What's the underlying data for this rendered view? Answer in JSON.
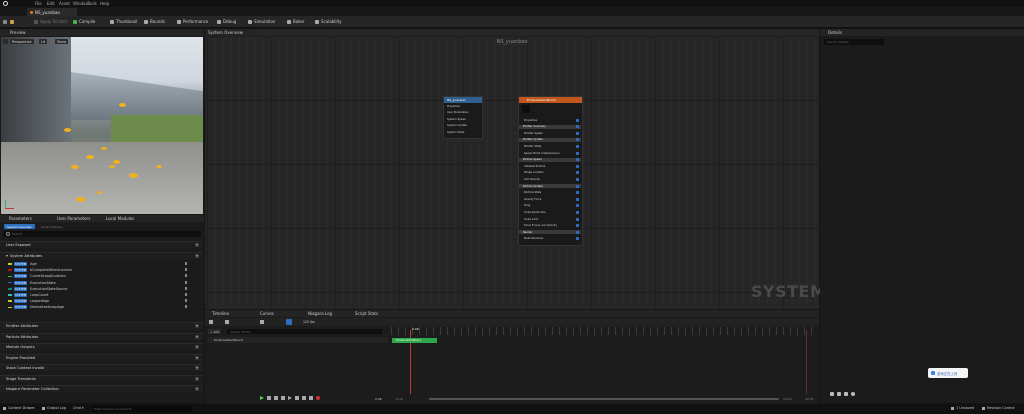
{
  "menu": [
    "File",
    "Edit",
    "Asset",
    "Window",
    "Tools",
    "Help"
  ],
  "tab": {
    "title": "NS_yuanbao"
  },
  "toolbar": {
    "apply": "Apply Scratch",
    "compile": "Compile",
    "thumbnail": "Thumbnail",
    "bounds": "Bounds",
    "performance": "Performance",
    "debug": "Debug",
    "simulation": "Simulation",
    "baker": "Baker",
    "scalability": "Scalability"
  },
  "preview": {
    "tab": "Preview",
    "view_mode": "Perspective",
    "lit": "Lit",
    "show": "Show"
  },
  "params": {
    "tabs": [
      "Parameters",
      "User Parameters",
      "Local Modules"
    ],
    "subtabs": [
      "System Overview",
      "Scratch Module"
    ],
    "search_placeholder": "Search",
    "user_exposed": "User Exposed",
    "system_attributes": "System Attributes",
    "system_tag": "SYSTEM",
    "attributes": [
      {
        "name": "Age",
        "color": "#c0d020"
      },
      {
        "name": "bCompleteWhenInactive",
        "color": "#b01818"
      },
      {
        "name": "CurrentLoopDuration",
        "color": "#30c030"
      },
      {
        "name": "ExecutionState",
        "color": "#3060c0"
      },
      {
        "name": "ExecutionStateSource",
        "color": "#108070"
      },
      {
        "name": "LoopCount",
        "color": "#30c0c0"
      },
      {
        "name": "LoopedAge",
        "color": "#c0d020"
      },
      {
        "name": "NormalizedLoopAge",
        "color": "#c0d020"
      }
    ],
    "categories": [
      "Emitter Attributes",
      "Particle Attributes",
      "Module Outputs",
      "Engine Provided",
      "Stack Context Invalid",
      "Stage Transients",
      "Niagara Parameter Collection"
    ]
  },
  "overview": {
    "tab": "System Overview",
    "title": "NS_yuanbao",
    "watermark": "SYSTEM",
    "system_node": {
      "title": "NS_yuanbao",
      "rows": [
        "Properties",
        "User Parameters",
        "System Spawn",
        "System Update",
        "System State"
      ]
    },
    "emitter_node": {
      "title": "EmissiveItemBoard",
      "rows": [
        {
          "label": "Properties",
          "kind": "row"
        },
        {
          "label": "Emitter Summary",
          "kind": "sect"
        },
        {
          "label": "Emitter Spawn",
          "kind": "row"
        },
        {
          "label": "Emitter Update",
          "kind": "sect"
        },
        {
          "label": "Emitter State",
          "kind": "row"
        },
        {
          "label": "Spawn Burst Instantaneous",
          "kind": "row"
        },
        {
          "label": "Particle Spawn",
          "kind": "sect"
        },
        {
          "label": "Initialize Particle",
          "kind": "row"
        },
        {
          "label": "Shape Location",
          "kind": "row"
        },
        {
          "label": "Add Velocity",
          "kind": "row"
        },
        {
          "label": "Particle Update",
          "kind": "sect"
        },
        {
          "label": "Particle State",
          "kind": "row"
        },
        {
          "label": "Gravity Force",
          "kind": "row"
        },
        {
          "label": "Drag",
          "kind": "row"
        },
        {
          "label": "Scale Sprite Size",
          "kind": "row"
        },
        {
          "label": "Scale Color",
          "kind": "row"
        },
        {
          "label": "Solve Forces and Velocity",
          "kind": "row"
        },
        {
          "label": "Render",
          "kind": "sect"
        },
        {
          "label": "Mesh Renderer",
          "kind": "row"
        }
      ]
    }
  },
  "details": {
    "tab": "Details",
    "search_placeholder": "Search Details"
  },
  "timeline": {
    "tabs": [
      "Timeline",
      "Curves",
      "Niagara Log",
      "Script Stats"
    ],
    "add": "Add",
    "search_placeholder": "Search Tracks",
    "fps": "120 fps",
    "track": "EmissiveItemBoard",
    "playhead": "0.06",
    "start": "0.00",
    "end_left": "-0.10",
    "end_right": "10.10",
    "end_far": "10.35",
    "time_value": "0.06"
  },
  "statusbar": {
    "content_drawer": "Content Drawer",
    "output_log": "Output Log",
    "cmd": "Cmd",
    "cmd_placeholder": "Enter Console Command",
    "unsaved": "1 Unsaved",
    "revision": "Revision Control"
  },
  "notice": {
    "text": "游戏正在上传"
  }
}
